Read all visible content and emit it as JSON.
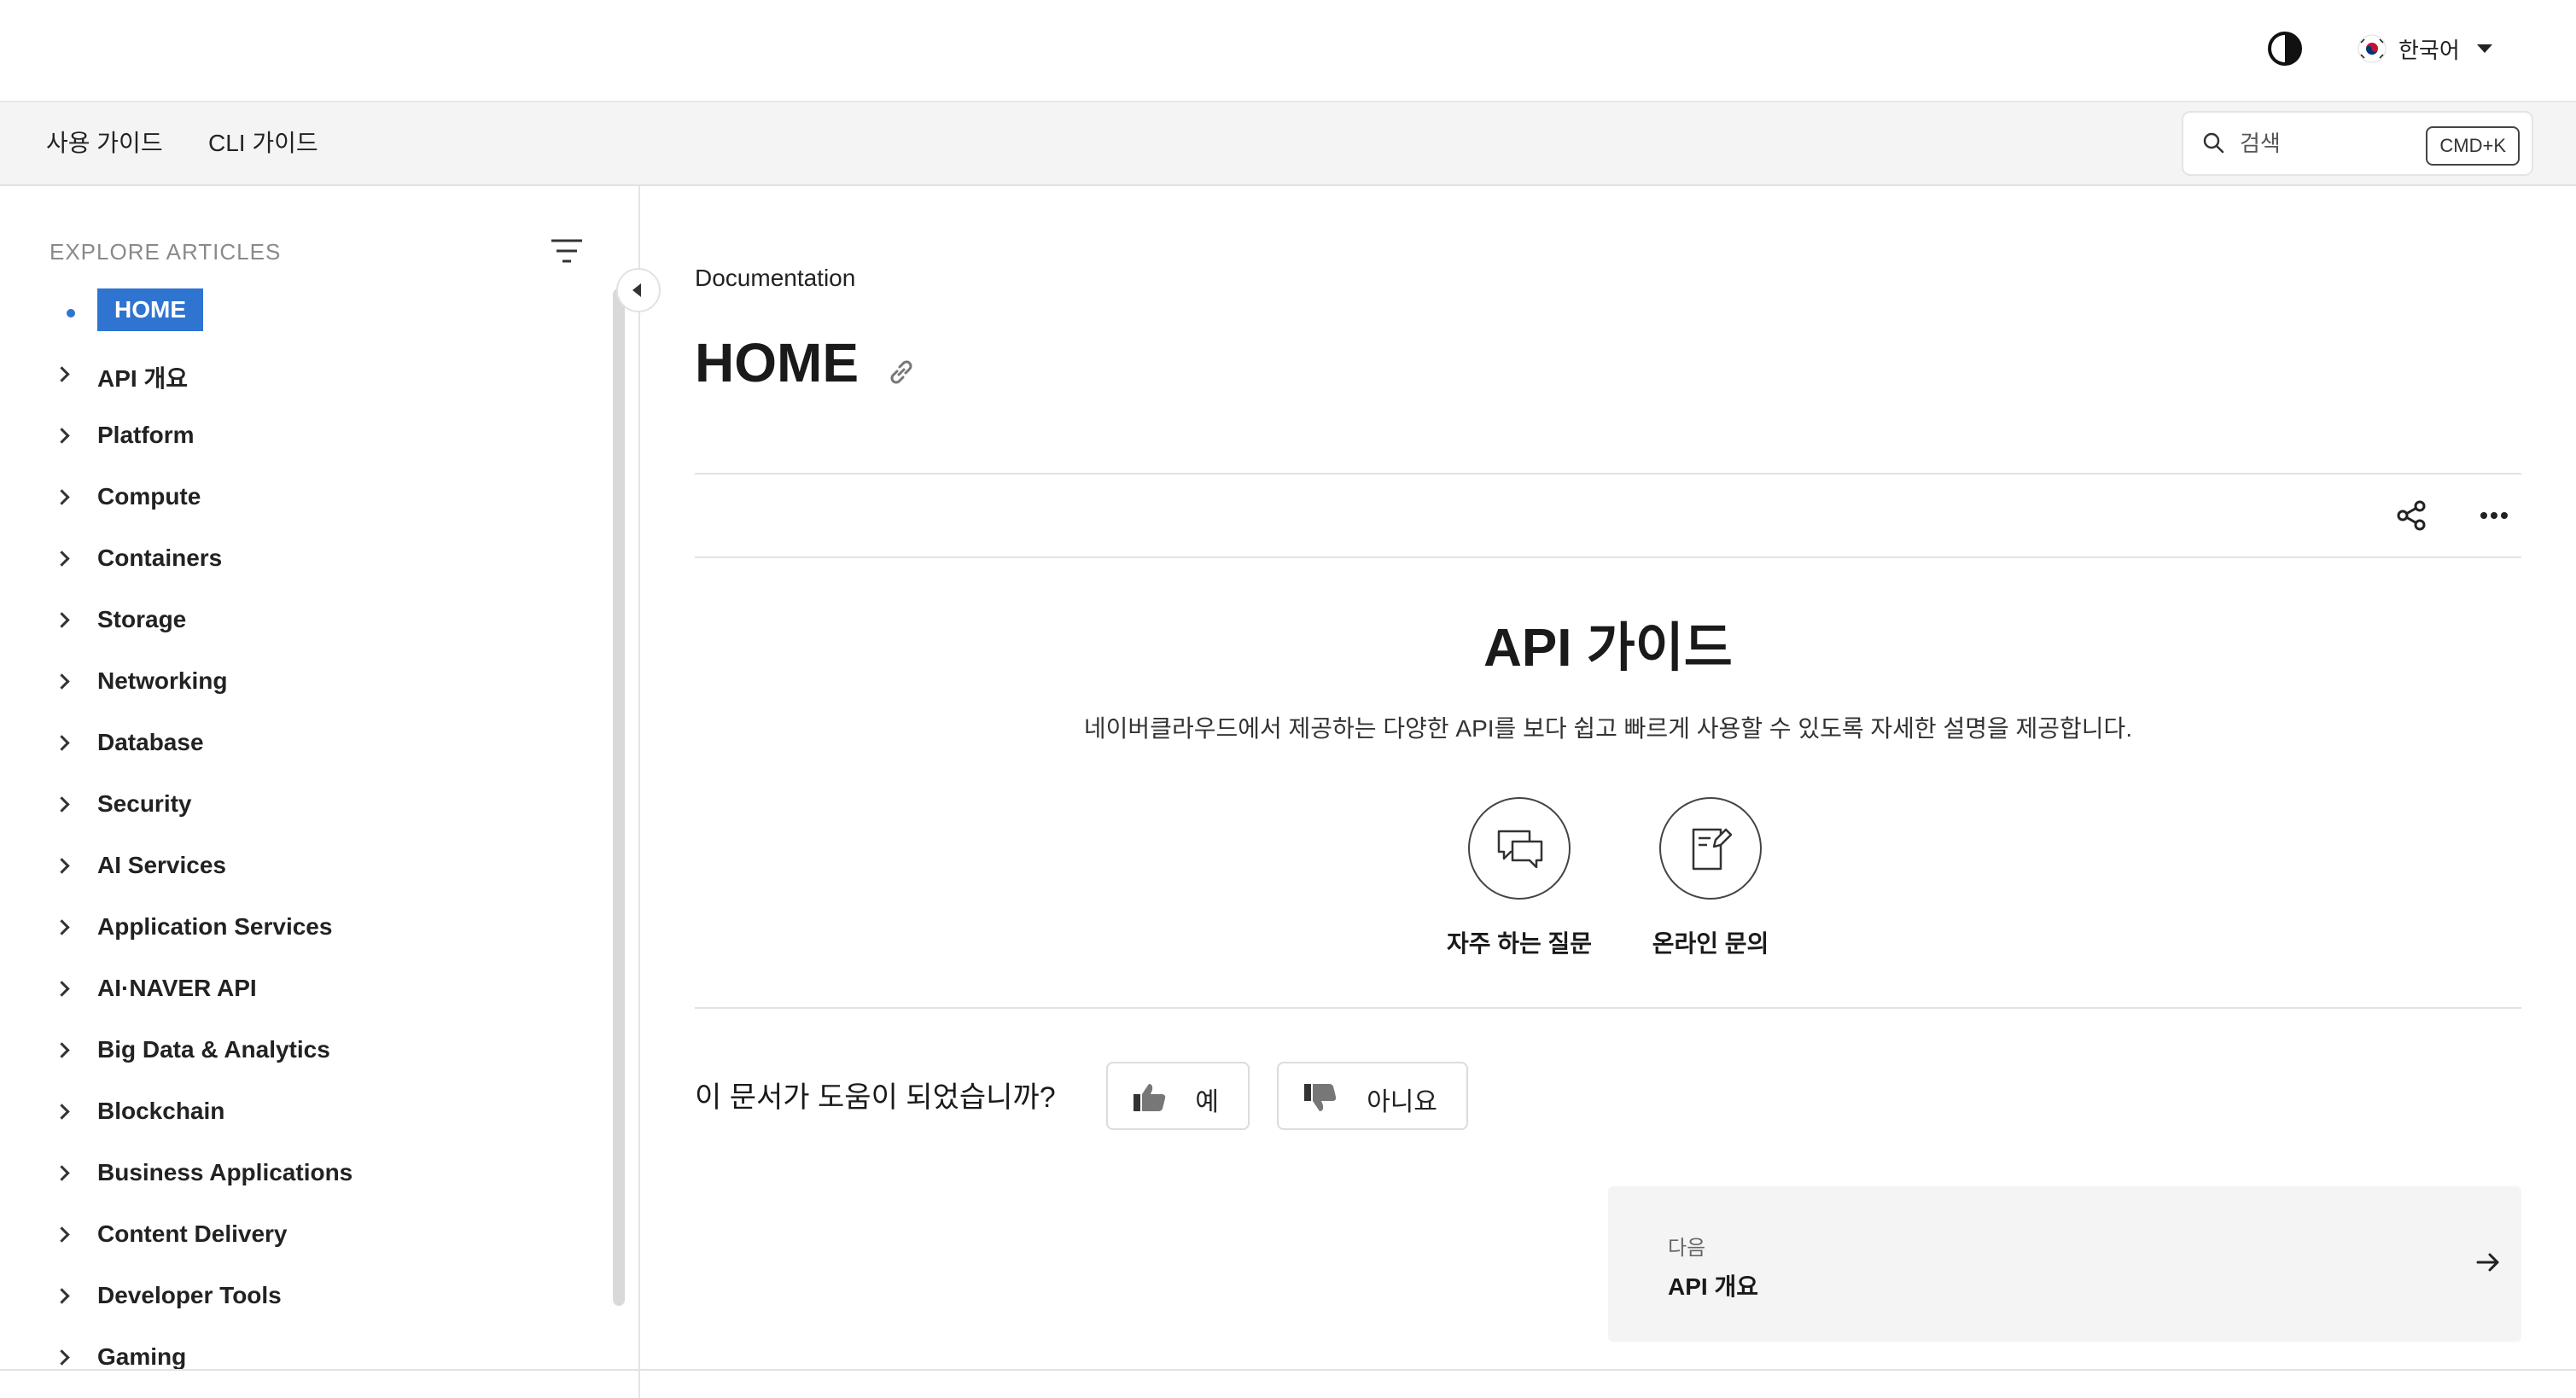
{
  "header": {
    "theme_toggle_icon": "contrast-icon",
    "language": {
      "flag_icon": "korea-flag-icon",
      "label": "한국어"
    }
  },
  "subnav": {
    "tabs": [
      {
        "label": "사용 가이드"
      },
      {
        "label": "CLI 가이드"
      }
    ],
    "search": {
      "placeholder": "검색",
      "shortcut": "CMD+K"
    }
  },
  "sidebar": {
    "heading": "EXPLORE ARTICLES",
    "active": "HOME",
    "items": [
      {
        "label": "API 개요"
      },
      {
        "label": "Platform"
      },
      {
        "label": "Compute"
      },
      {
        "label": "Containers"
      },
      {
        "label": "Storage"
      },
      {
        "label": "Networking"
      },
      {
        "label": "Database"
      },
      {
        "label": "Security"
      },
      {
        "label": "AI Services"
      },
      {
        "label": "Application Services"
      },
      {
        "label": "AI·NAVER API"
      },
      {
        "label": "Big Data & Analytics"
      },
      {
        "label": "Blockchain"
      },
      {
        "label": "Business Applications"
      },
      {
        "label": "Content Delivery"
      },
      {
        "label": "Developer Tools"
      },
      {
        "label": "Gaming"
      }
    ]
  },
  "main": {
    "breadcrumb": "Documentation",
    "title": "HOME",
    "hero": {
      "title": "API 가이드",
      "description": "네이버클라우드에서 제공하는 다양한 API를 보다 쉽고 빠르게 사용할 수 있도록 자세한 설명을 제공합니다."
    },
    "quick_links": [
      {
        "label": "자주 하는 질문",
        "icon": "chat-bubbles-icon"
      },
      {
        "label": "온라인 문의",
        "icon": "edit-document-icon"
      }
    ],
    "feedback": {
      "question": "이 문서가 도움이 되었습니까?",
      "yes": "예",
      "no": "아니요"
    },
    "next": {
      "kicker": "다음",
      "title": "API 개요"
    }
  },
  "colors": {
    "accent": "#2f74d0",
    "subnav_bg": "#f4f4f4",
    "card_bg": "#f4f4f4"
  }
}
